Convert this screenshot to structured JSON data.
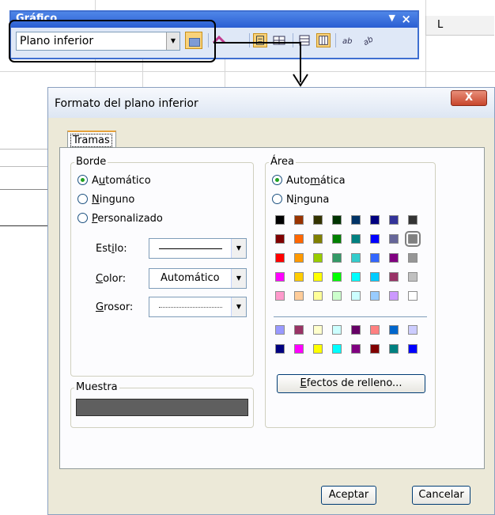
{
  "sheet": {
    "column_letter": "L"
  },
  "toolbar": {
    "title": "Gráfico",
    "menu_arrow": "▼",
    "close": "×",
    "combo_value": "Plano inferior",
    "icons": [
      "format-selected-icon",
      "chart-type-icon",
      "legend-icon",
      "data-table-icon",
      "by-row-icon",
      "by-column-icon",
      "angle-text-down-icon",
      "angle-text-up-icon"
    ]
  },
  "dialog": {
    "title": "Formato del plano inferior",
    "close": "X",
    "tab": "Tramas",
    "border": {
      "label": "Borde",
      "options": [
        {
          "pre": "A",
          "acc": "u",
          "post": "tomático",
          "checked": true
        },
        {
          "pre": "",
          "acc": "N",
          "post": "inguno",
          "checked": false
        },
        {
          "pre": "",
          "acc": "P",
          "post": "ersonalizado",
          "checked": false
        }
      ],
      "style_label": {
        "pre": "Est",
        "acc": "i",
        "post": "lo:"
      },
      "color_label": {
        "pre": "",
        "acc": "C",
        "post": "olor:"
      },
      "color_value": "Automático",
      "weight_label": {
        "pre": "",
        "acc": "G",
        "post": "rosor:"
      }
    },
    "sample_label": "Muestra",
    "area": {
      "label": "Área",
      "options": [
        {
          "pre": "Auto",
          "acc": "m",
          "post": "ática",
          "checked": true
        },
        {
          "pre": "N",
          "acc": "i",
          "post": "nguna",
          "checked": false
        }
      ],
      "palette": [
        [
          "#000000",
          "#993300",
          "#333300",
          "#003300",
          "#003366",
          "#000080",
          "#333399",
          "#333333"
        ],
        [
          "#800000",
          "#ff6600",
          "#808000",
          "#008000",
          "#008080",
          "#0000ff",
          "#666699",
          "#808080"
        ],
        [
          "#ff0000",
          "#ff9900",
          "#99cc00",
          "#339966",
          "#33cccc",
          "#3366ff",
          "#800080",
          "#969696"
        ],
        [
          "#ff00ff",
          "#ffcc00",
          "#ffff00",
          "#00ff00",
          "#00ffff",
          "#00ccff",
          "#993366",
          "#c0c0c0"
        ],
        [
          "#ff99cc",
          "#ffcc99",
          "#ffff99",
          "#ccffcc",
          "#ccffff",
          "#99ccff",
          "#cc99ff",
          "#ffffff"
        ]
      ],
      "palette_extra": [
        [
          "#9999ff",
          "#993366",
          "#ffffcc",
          "#ccffff",
          "#660066",
          "#ff8080",
          "#0066cc",
          "#ccccff"
        ],
        [
          "#000080",
          "#ff00ff",
          "#ffff00",
          "#00ffff",
          "#800080",
          "#800000",
          "#008080",
          "#0000ff"
        ]
      ],
      "selected_color": "#808080",
      "fill_effects": {
        "pre": "",
        "acc": "E",
        "post": "fectos de relleno..."
      }
    },
    "ok": "Aceptar",
    "cancel": "Cancelar"
  }
}
